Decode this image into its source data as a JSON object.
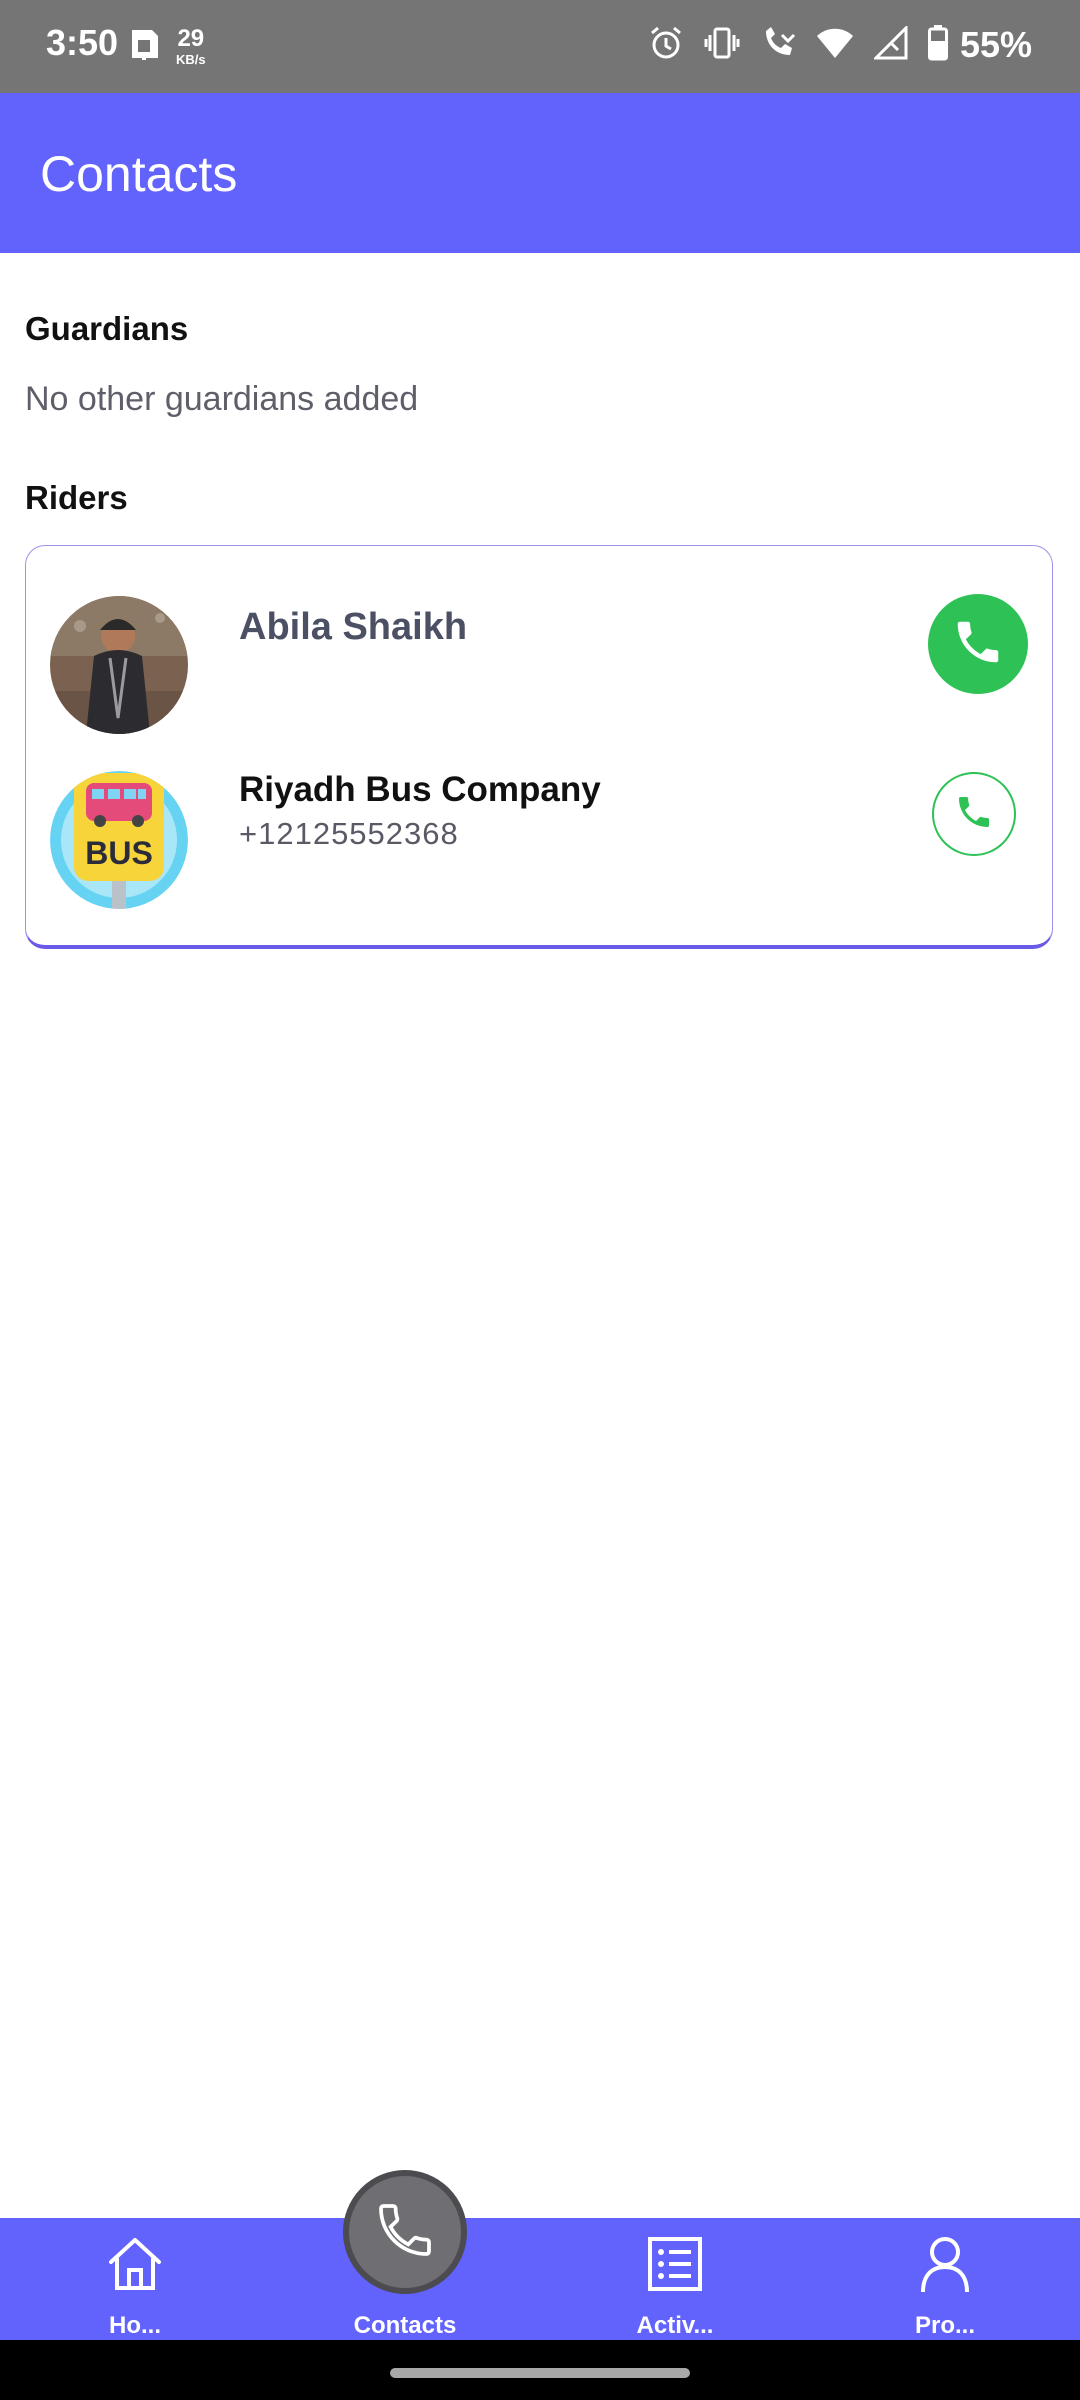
{
  "status_bar": {
    "time": "3:50",
    "net_speed_value": "29",
    "net_speed_unit": "KB/s",
    "battery": "55%",
    "icons": [
      "sim-card-icon",
      "alarm-icon",
      "vibrate-icon",
      "wifi-calling-icon",
      "wifi-icon",
      "signal-icon",
      "battery-icon"
    ]
  },
  "app_bar": {
    "title": "Contacts"
  },
  "guardians": {
    "title": "Guardians",
    "empty_text": "No other guardians added"
  },
  "riders": {
    "title": "Riders",
    "contacts": [
      {
        "name": "Abila Shaikh",
        "phone": "",
        "avatar": "child-photo"
      },
      {
        "name": "Riyadh Bus Company",
        "phone": "+12125552368",
        "avatar": "bus-stop-icon"
      }
    ]
  },
  "colors": {
    "primary": "#6262fd",
    "call_green": "#2ec256",
    "status_bar": "#757575"
  },
  "bottom_nav": {
    "items": [
      {
        "label": "Ho...",
        "icon": "home-icon"
      },
      {
        "label": "Contacts",
        "icon": "phone-icon",
        "active": true
      },
      {
        "label": "Activ...",
        "icon": "list-icon"
      },
      {
        "label": "Pro...",
        "icon": "profile-icon"
      }
    ]
  }
}
